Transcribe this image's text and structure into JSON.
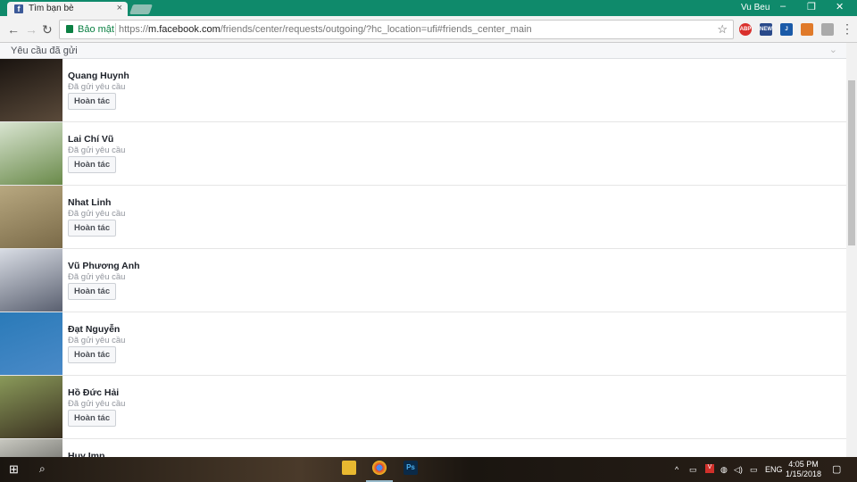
{
  "browser": {
    "tab_title": "Tìm bạn bè",
    "tab_favicon": "f",
    "tab_close": "×",
    "window_user": "Vu Beu",
    "secure_label": "Bảo mật",
    "url_prefix": "https://",
    "url_host": "m.facebook.com",
    "url_path": "/friends/center/requests/outgoing/?hc_location=ufi#friends_center_main",
    "extensions": [
      "abp-icon",
      "news-icon",
      "j-icon",
      "extension-icon",
      "puzzle-icon"
    ]
  },
  "page": {
    "section_title": "Yêu cầu đã gửi",
    "status_text": "Đã gửi yêu cầu",
    "undo_label": "Hoàn tác",
    "requests": [
      {
        "name": "Quang Huynh",
        "colors": [
          "#1a1410",
          "#5a4a3a"
        ]
      },
      {
        "name": "Lai Chí Vũ",
        "colors": [
          "#d8e4d0",
          "#6a8a4a"
        ]
      },
      {
        "name": "Nhat Linh",
        "colors": [
          "#b8a880",
          "#7a6a48"
        ]
      },
      {
        "name": "Vũ Phương Anh",
        "colors": [
          "#d8dce4",
          "#5a6070"
        ]
      },
      {
        "name": "Đạt Nguyễn",
        "colors": [
          "#2a7ab8",
          "#4a8ac8"
        ]
      },
      {
        "name": "Hồ Đức Hải",
        "colors": [
          "#8a9a5a",
          "#3a3020"
        ]
      },
      {
        "name": "Huy Imp",
        "colors": [
          "#c8c8c0",
          "#3a3a38"
        ]
      }
    ]
  },
  "taskbar": {
    "time": "4:05 PM",
    "date": "1/15/2018",
    "lang": "ENG"
  }
}
